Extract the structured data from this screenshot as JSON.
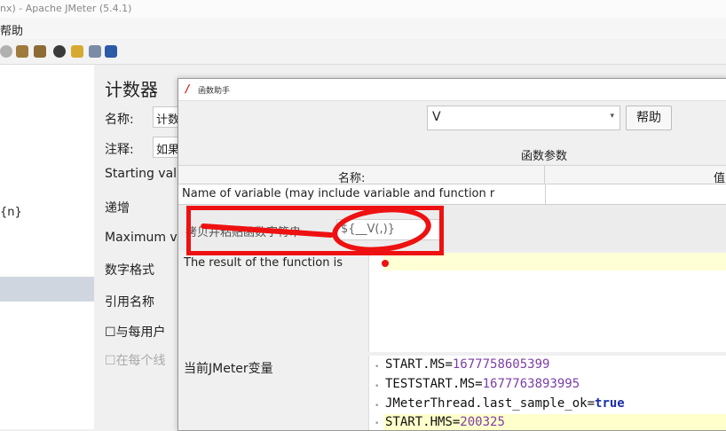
{
  "window": {
    "title": "nx) - Apache JMeter (5.4.1)"
  },
  "menu": {
    "help": "帮助"
  },
  "tree": {
    "item_label": "{n}"
  },
  "counter": {
    "title": "计数器",
    "name_label": "名称:",
    "name_value": "计数",
    "comment_label": "注释:",
    "comment_value": "如果",
    "starting_label": "Starting val",
    "increment_label": "递增",
    "maximum_label": "Maximum v",
    "format_label": "数字格式",
    "ref_name_label": "引用名称",
    "per_user_label": "与每用户",
    "per_thread_label": "在每个线"
  },
  "dialog": {
    "title": "函数助手",
    "function_select": "V",
    "help_button": "帮助",
    "params_title": "函数参数",
    "table": {
      "header_name": "名称:",
      "header_value": "值",
      "rows": [
        {
          "name": "Name of variable (may include variable and function r",
          "value": ""
        }
      ]
    },
    "copy_label": "拷贝并粘贴函数字符串",
    "copy_value": "${__V(,)}",
    "result_label": "The result of the function is",
    "vars_label": "当前JMeter变量",
    "variables": [
      {
        "key": "START.MS",
        "value": "1677758605399"
      },
      {
        "key": "TESTSTART.MS",
        "value": "1677763893995"
      },
      {
        "key": "JMeterThread.last_sample_ok",
        "value": "true"
      },
      {
        "key": "START.HMS",
        "value": "200325"
      }
    ]
  },
  "colors": {
    "annotation": "#ee1111",
    "highlight": "#ffffcc",
    "var_value": "#7b3fa6"
  }
}
